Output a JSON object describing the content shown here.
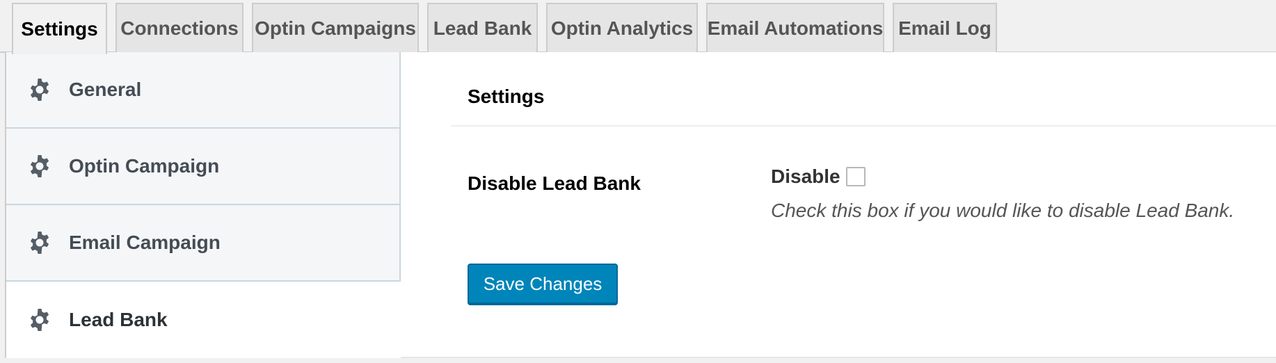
{
  "tabs": [
    {
      "label": "Settings",
      "active": true
    },
    {
      "label": "Connections",
      "active": false
    },
    {
      "label": "Optin Campaigns",
      "active": false
    },
    {
      "label": "Lead Bank",
      "active": false
    },
    {
      "label": "Optin Analytics",
      "active": false
    },
    {
      "label": "Email Automations",
      "active": false
    },
    {
      "label": "Email Log",
      "active": false
    }
  ],
  "sidebar": {
    "items": [
      {
        "label": "General",
        "icon": "gear-icon",
        "active": false
      },
      {
        "label": "Optin Campaign",
        "icon": "gear-icon",
        "active": false
      },
      {
        "label": "Email Campaign",
        "icon": "gear-icon",
        "active": false
      },
      {
        "label": "Lead Bank",
        "icon": "gear-icon",
        "active": true
      }
    ]
  },
  "main": {
    "section_title": "Settings",
    "field_label": "Disable Lead Bank",
    "checkbox_label": "Disable",
    "checkbox_checked": false,
    "description": "Check this box if you would like to disable Lead Bank.",
    "save_label": "Save Changes"
  },
  "colors": {
    "page_bg": "#f1f1f1",
    "primary_button": "#0085ba",
    "menu_bg": "#f5f6f8",
    "icon": "#555d66"
  }
}
